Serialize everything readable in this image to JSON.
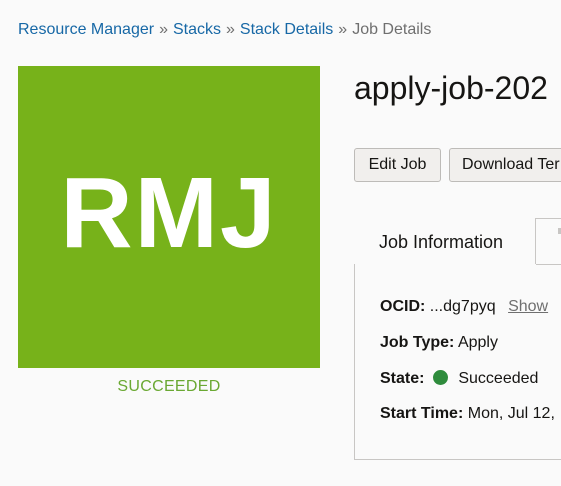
{
  "breadcrumb": {
    "items": [
      "Resource Manager",
      "Stacks",
      "Stack Details"
    ],
    "separator": "»",
    "current": "Job Details"
  },
  "badge": {
    "initials": "RMJ",
    "status": "SUCCEEDED",
    "color": "#77b21a",
    "status_color": "#6aa832"
  },
  "job": {
    "title": "apply-job-202"
  },
  "actions": {
    "edit_label": "Edit Job",
    "download_label": "Download Ter"
  },
  "tabs": {
    "active_label": "Job Information"
  },
  "info": {
    "ocid_label": "OCID:",
    "ocid_value": "...dg7pyq",
    "ocid_show": "Show",
    "type_label": "Job Type:",
    "type_value": "Apply",
    "state_label": "State:",
    "state_value": "Succeeded",
    "state_color": "#2e8b3c",
    "start_label": "Start Time:",
    "start_value": "Mon, Jul 12,"
  }
}
